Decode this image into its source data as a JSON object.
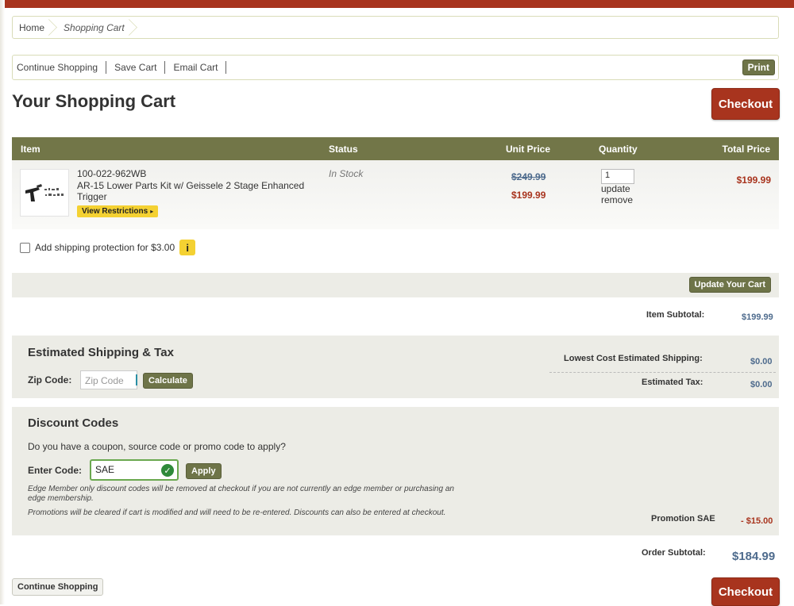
{
  "breadcrumb": {
    "home": "Home",
    "current": "Shopping Cart"
  },
  "toolbar": {
    "continue": "Continue Shopping",
    "save": "Save Cart",
    "email": "Email Cart",
    "print": "Print"
  },
  "page": {
    "title": "Your Shopping Cart",
    "checkout": "Checkout"
  },
  "table": {
    "headers": {
      "item": "Item",
      "status": "Status",
      "unit_price": "Unit Price",
      "quantity": "Quantity",
      "total_price": "Total Price"
    },
    "row": {
      "sku": "100-022-962WB",
      "name": "AR-15 Lower Parts Kit w/ Geissele 2 Stage Enhanced Trigger",
      "restrictions": "View Restrictions",
      "status": "In Stock",
      "original_price": "$249.99",
      "sale_price": "$199.99",
      "quantity": "1",
      "update": "update",
      "remove": "remove",
      "total": "$199.99"
    }
  },
  "protection": {
    "label": "Add shipping protection for $3.00",
    "info": "i",
    "checked": false
  },
  "update_cart": "Update Your Cart",
  "subtotal": {
    "label": "Item Subtotal:",
    "value": "$199.99"
  },
  "shipping": {
    "title": "Estimated Shipping & Tax",
    "zip_label": "Zip Code:",
    "zip_placeholder": "Zip Code",
    "calculate": "Calculate",
    "shipping_label": "Lowest Cost Estimated Shipping:",
    "shipping_value": "$0.00",
    "tax_label": "Estimated Tax:",
    "tax_value": "$0.00"
  },
  "discount": {
    "title": "Discount Codes",
    "question": "Do you have a coupon, source code or promo code to apply?",
    "code_label": "Enter Code:",
    "code_value": "SAE",
    "apply": "Apply",
    "note1": "Edge Member only discount codes will be removed at checkout if you are not currently an edge member or purchasing an edge membership.",
    "note2": "Promotions will be cleared if cart is modified and will need to be re-entered. Discounts can also be entered at checkout.",
    "promo_label": "Promotion SAE",
    "promo_value": "- $15.00"
  },
  "order": {
    "label": "Order Subtotal:",
    "value": "$184.99"
  },
  "bottom": {
    "continue": "Continue Shopping",
    "checkout": "Checkout"
  },
  "colors": {
    "brand_red": "#a8341e",
    "olive": "#6e7448",
    "price_blue": "#4e6b8d",
    "highlight_yellow": "#f4d132"
  }
}
